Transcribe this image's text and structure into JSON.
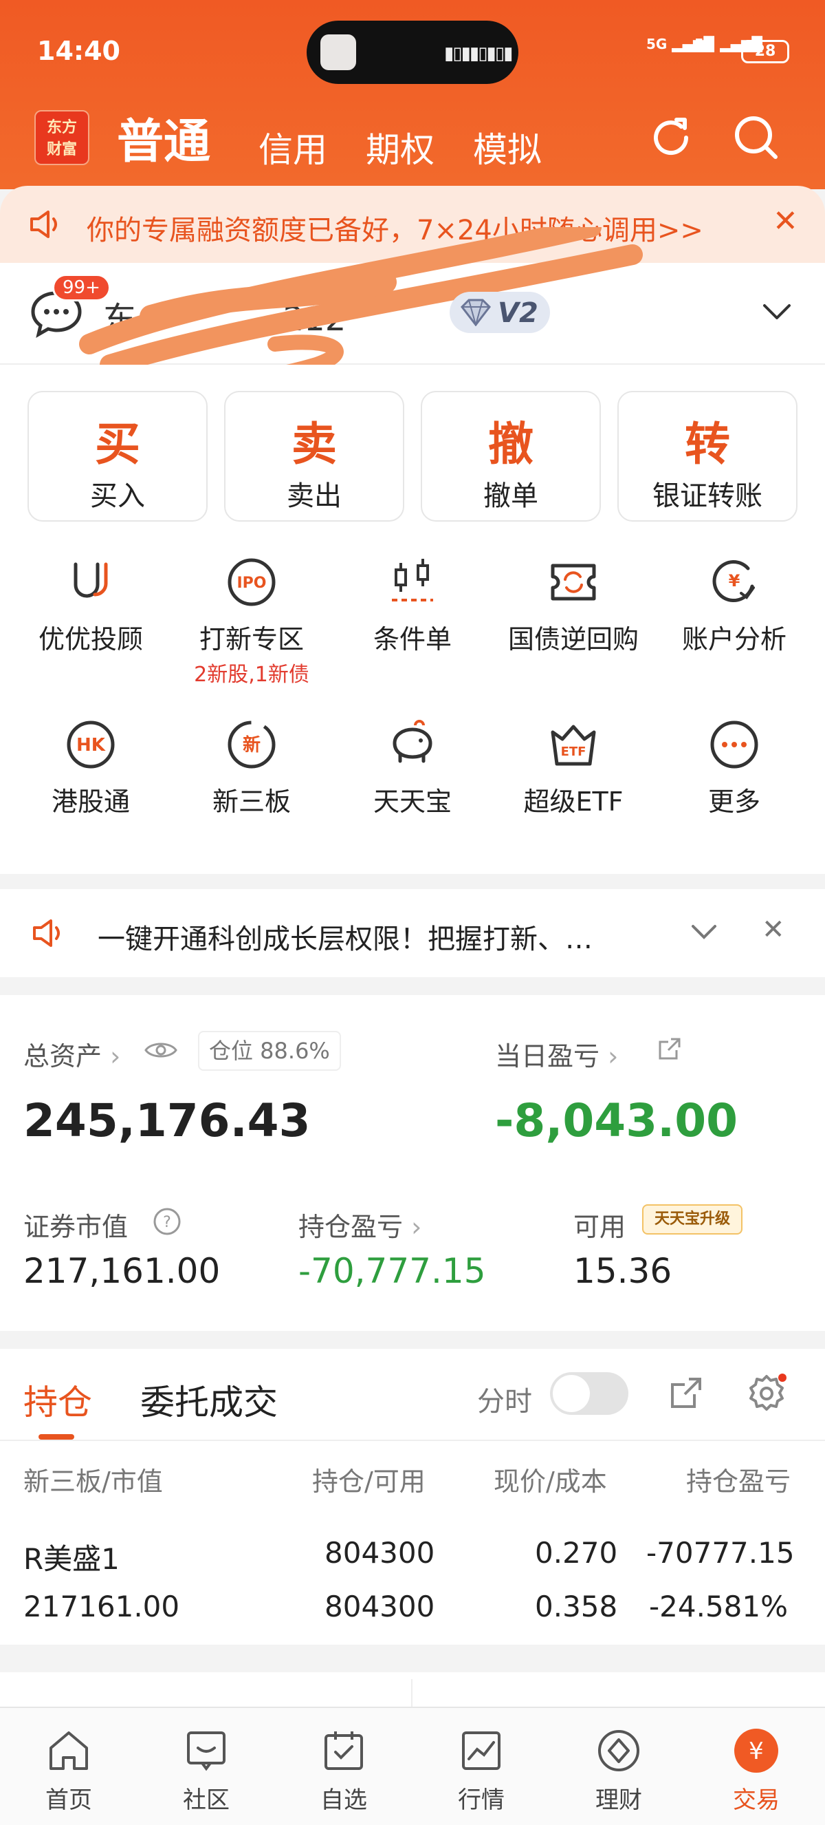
{
  "status_bar": {
    "time": "14:40",
    "signal_1": "5G",
    "signal_2": "5G",
    "battery": "28"
  },
  "header": {
    "logo_line1": "东方",
    "logo_line2": "财富",
    "tabs": [
      {
        "label": "普通"
      },
      {
        "label": "信用"
      },
      {
        "label": "期权"
      },
      {
        "label": "模拟"
      }
    ]
  },
  "notice": {
    "text": "你的专属融资额度已备好，7×24小时随心调用>>"
  },
  "account": {
    "badge": "99+",
    "name_visible_suffix": "212",
    "level": "V2"
  },
  "actions": [
    {
      "big": "买",
      "label": "买入"
    },
    {
      "big": "卖",
      "label": "卖出"
    },
    {
      "big": "撤",
      "label": "撤单"
    },
    {
      "big": "转",
      "label": "银证转账"
    }
  ],
  "grid": [
    {
      "label": "优优投顾",
      "sub": ""
    },
    {
      "label": "打新专区",
      "sub": "2新股,1新债"
    },
    {
      "label": "条件单",
      "sub": ""
    },
    {
      "label": "国债逆回购",
      "sub": ""
    },
    {
      "label": "账户分析",
      "sub": ""
    },
    {
      "label": "港股通",
      "sub": ""
    },
    {
      "label": "新三板",
      "sub": ""
    },
    {
      "label": "天天宝",
      "sub": ""
    },
    {
      "label": "超级ETF",
      "sub": ""
    },
    {
      "label": "更多",
      "sub": ""
    }
  ],
  "notice2": {
    "text": "一键开通科创成长层权限！把握打新、…"
  },
  "assets": {
    "total_label": "总资产",
    "position_chip": "仓位 88.6%",
    "total_value": "245,176.43",
    "daily_pl_label": "当日盈亏",
    "daily_pl_value": "-8,043.00",
    "market_value_label": "证券市值",
    "market_value": "217,161.00",
    "holding_pl_label": "持仓盈亏",
    "holding_pl_value": "-70,777.15",
    "available_label": "可用",
    "available_badge": "天天宝升级",
    "available_value": "15.36"
  },
  "positions": {
    "tabs": [
      {
        "label": "持仓"
      },
      {
        "label": "委托成交"
      }
    ],
    "timeshare_label": "分时",
    "columns": [
      "新三板/市值",
      "持仓/可用",
      "现价/成本",
      "持仓盈亏"
    ],
    "rows": [
      {
        "name": "R美盛1",
        "market_value": "217161.00",
        "holding": "804300",
        "available": "804300",
        "price": "0.270",
        "cost": "0.358",
        "pl": "-70777.15",
        "pl_pct": "-24.581%"
      }
    ]
  },
  "bottom_nav": [
    {
      "label": "首页"
    },
    {
      "label": "社区"
    },
    {
      "label": "自选"
    },
    {
      "label": "行情"
    },
    {
      "label": "理财"
    },
    {
      "label": "交易"
    }
  ],
  "colors": {
    "brand": "#f05a24",
    "loss": "#2e9e3e",
    "accent": "#e8541f"
  }
}
